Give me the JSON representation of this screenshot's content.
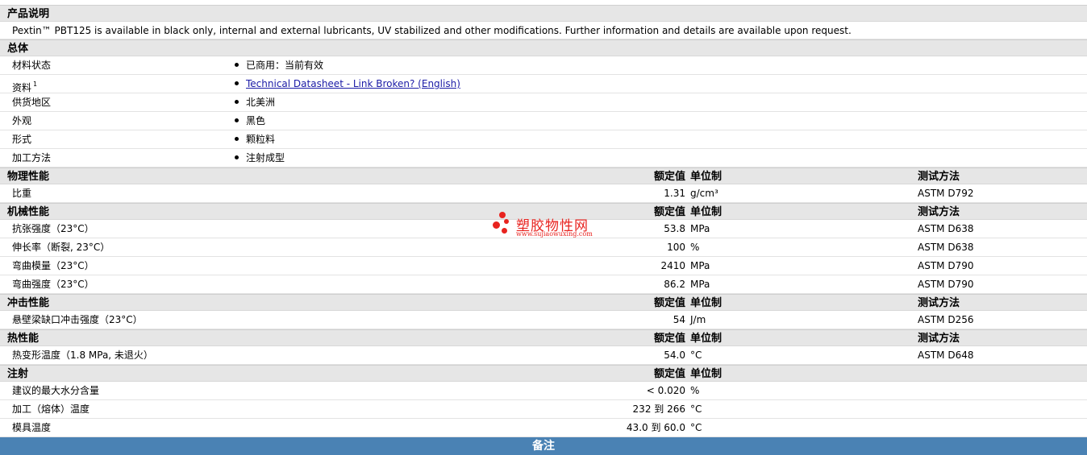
{
  "description": {
    "title": "产品说明",
    "text": "Pextin™ PBT125 is available in black only, internal and external lubricants, UV stabilized and other modifications. Further information and details are available upon request."
  },
  "general": {
    "title": "总体",
    "rows": [
      {
        "label": "材料状态",
        "sup": "",
        "value": "已商用：当前有效",
        "link": false
      },
      {
        "label": "资料",
        "sup": "1",
        "value": "Technical Datasheet - Link Broken? (English)",
        "link": true
      },
      {
        "label": "供货地区",
        "sup": "",
        "value": "北美洲",
        "link": false
      },
      {
        "label": "外观",
        "sup": "",
        "value": "黑色",
        "link": false
      },
      {
        "label": "形式",
        "sup": "",
        "value": "颗粒料",
        "link": false
      },
      {
        "label": "加工方法",
        "sup": "",
        "value": "注射成型",
        "link": false
      }
    ]
  },
  "headers": {
    "value": "额定值",
    "unit": "单位制",
    "method": "测试方法"
  },
  "physical": {
    "title": "物理性能",
    "rows": [
      {
        "label": "比重",
        "value": "1.31",
        "unit": "g/cm³",
        "method": "ASTM D792"
      }
    ]
  },
  "mechanical": {
    "title": "机械性能",
    "rows": [
      {
        "label": "抗张强度（23°C）",
        "value": "53.8",
        "unit": "MPa",
        "method": "ASTM D638"
      },
      {
        "label": "伸长率（断裂, 23°C）",
        "value": "100",
        "unit": "%",
        "method": "ASTM D638"
      },
      {
        "label": "弯曲模量（23°C）",
        "value": "2410",
        "unit": "MPa",
        "method": "ASTM D790"
      },
      {
        "label": "弯曲强度（23°C）",
        "value": "86.2",
        "unit": "MPa",
        "method": "ASTM D790"
      }
    ]
  },
  "impact": {
    "title": "冲击性能",
    "rows": [
      {
        "label": "悬壁梁缺口冲击强度（23°C）",
        "value": "54",
        "unit": "J/m",
        "method": "ASTM D256"
      }
    ]
  },
  "thermal": {
    "title": "热性能",
    "rows": [
      {
        "label": "热变形温度（1.8 MPa, 未退火）",
        "value": "54.0",
        "unit": "°C",
        "method": "ASTM D648"
      }
    ]
  },
  "injection": {
    "title": "注射",
    "rows": [
      {
        "label": "建议的最大水分含量",
        "value": "< 0.020",
        "unit": "%",
        "method": ""
      },
      {
        "label": "加工（熔体）温度",
        "value": "232 到  266",
        "unit": "°C",
        "method": ""
      },
      {
        "label": "模具温度",
        "value": "43.0 到  60.0",
        "unit": "°C",
        "method": ""
      }
    ]
  },
  "notes": {
    "title": "备注"
  },
  "watermark": {
    "name": "塑胶物性网",
    "url": "www.sujiaowuxing.com",
    "color": "#e8231f"
  }
}
